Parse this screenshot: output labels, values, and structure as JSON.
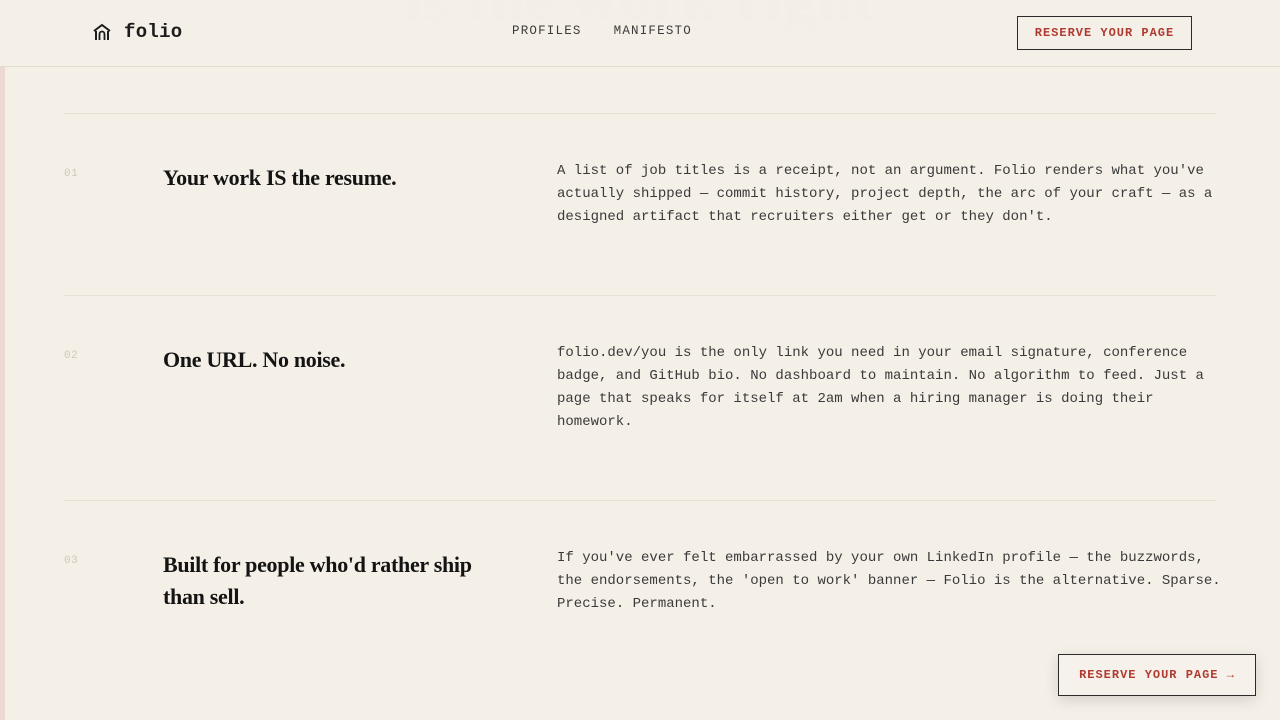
{
  "ghost_heading": "is the work right",
  "brand": {
    "name": "folio",
    "icon": "arch-house-icon"
  },
  "nav": {
    "items": [
      "PROFILES",
      "MANIFESTO"
    ]
  },
  "header_cta": "RESERVE YOUR PAGE",
  "rows": [
    {
      "num": "01",
      "headline": "Your work IS the resume.",
      "body": "A list of job titles is a receipt, not an argument. Folio renders what you've actually shipped — commit history, project depth, the arc of your craft — as a designed artifact that recruiters either get or they don't."
    },
    {
      "num": "02",
      "headline": "One URL. No noise.",
      "body": "folio.dev/you is the only link you need in your email signature, conference badge, and GitHub bio. No dashboard to maintain. No algorithm to feed. Just a page that speaks for itself at 2am when a hiring manager is doing their homework."
    },
    {
      "num": "03",
      "headline": "Built for people who'd rather ship than sell.",
      "body": "If you've ever felt embarrassed by your own LinkedIn profile — the buzzwords, the endorsements, the 'open to work' banner — Folio is the alternative. Sparse. Precise. Permanent."
    }
  ],
  "floating_cta": "RESERVE YOUR PAGE →",
  "colors": {
    "background": "#f4efe7",
    "accent": "#b03a30",
    "ink": "#141414"
  }
}
